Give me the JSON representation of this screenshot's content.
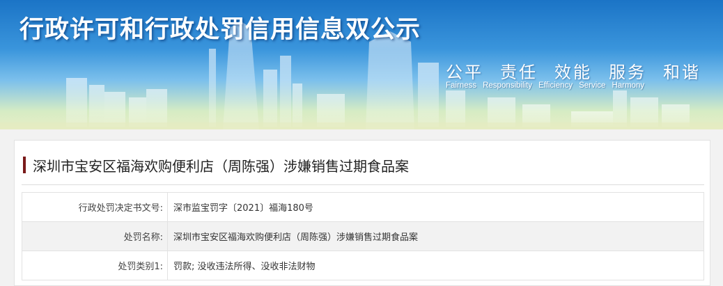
{
  "banner": {
    "title": "行政许可和行政处罚信用信息双公示",
    "slogans": [
      "公平",
      "责任",
      "效能",
      "服务",
      "和谐"
    ],
    "slogans_en": [
      "Fairness",
      "Responsibility",
      "Efficiency",
      "Service",
      "Harmony"
    ]
  },
  "case": {
    "title": "深圳市宝安区福海欢购便利店（周陈强）涉嫌销售过期食品案",
    "rows": [
      {
        "label": "行政处罚决定书文号:",
        "value": "深市监宝罚字〔2021〕福海180号"
      },
      {
        "label": "处罚名称:",
        "value": "深圳市宝安区福海欢购便利店（周陈强）涉嫌销售过期食品案"
      },
      {
        "label": "处罚类别1:",
        "value": "罚款; 没收违法所得、没收非法财物"
      }
    ]
  },
  "colors": {
    "sky_top": "#1b74c6",
    "title_mark": "#7a1a1a",
    "page_bg": "#f2f2f2"
  }
}
